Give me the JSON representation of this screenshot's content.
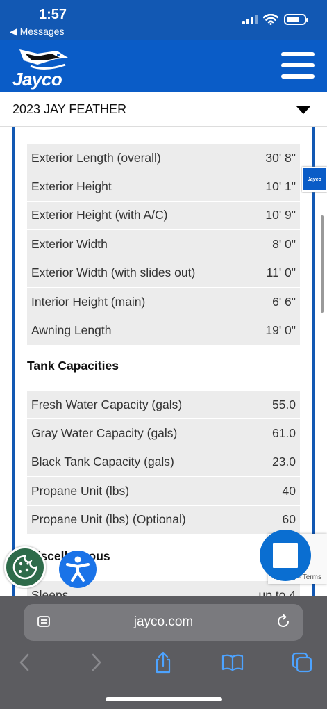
{
  "status_bar": {
    "time": "1:57",
    "back_label": "◀ Messages"
  },
  "header": {
    "logo_text": "Jayco",
    "side_tab_text": "Jayco"
  },
  "model_selector": {
    "title": "2023 JAY FEATHER"
  },
  "dimensions": {
    "rows": [
      {
        "label": "Exterior Length (overall)",
        "value": "30' 8\""
      },
      {
        "label": "Exterior Height",
        "value": "10' 1\""
      },
      {
        "label": "Exterior Height (with A/C)",
        "value": "10' 9\""
      },
      {
        "label": "Exterior Width",
        "value": "8' 0\""
      },
      {
        "label": "Exterior Width (with slides out)",
        "value": "11' 0\""
      },
      {
        "label": "Interior Height (main)",
        "value": "6' 6\""
      },
      {
        "label": "Awning Length",
        "value": "19' 0\""
      }
    ]
  },
  "tank_capacities": {
    "title": "Tank Capacities",
    "rows": [
      {
        "label": "Fresh Water Capacity (gals)",
        "value": "55.0"
      },
      {
        "label": "Gray Water Capacity (gals)",
        "value": "61.0"
      },
      {
        "label": "Black Tank Capacity (gals)",
        "value": "23.0"
      },
      {
        "label": "Propane Unit (lbs)",
        "value": "40"
      },
      {
        "label": "Propane Unit (lbs) (Optional)",
        "value": "60"
      }
    ]
  },
  "miscellaneous": {
    "title": "Miscellaneous",
    "rows": [
      {
        "label": "Sleeps",
        "value": "up to 4"
      }
    ]
  },
  "recaptcha": {
    "text": "Privacy - Terms"
  },
  "browser": {
    "url": "jayco.com"
  },
  "colors": {
    "brand_blue": "#0a5cc7",
    "cookie_green": "#2e6b4a",
    "accessibility_blue": "#1a73e8"
  }
}
